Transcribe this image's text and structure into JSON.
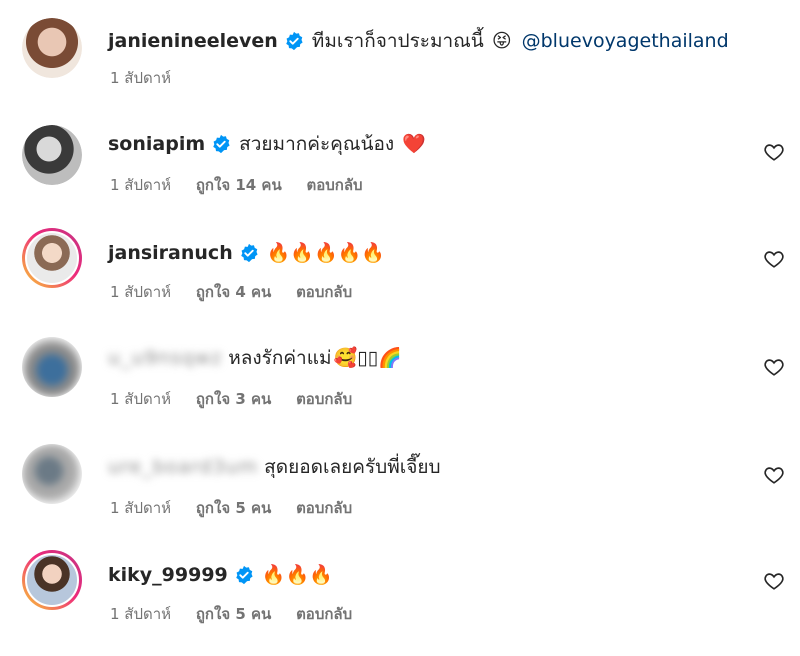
{
  "comments": [
    {
      "username": "janienineeleven",
      "text": "ทีมเราก็จาประมาณนี้",
      "emoji": "😝",
      "mention": "@bluevoyagethailand",
      "time": "1 สัปดาห์",
      "likes": "",
      "reply": ""
    },
    {
      "username": "soniapim",
      "text": "สวยมากค่ะคุณน้อง",
      "emoji": "❤️",
      "time": "1 สัปดาห์",
      "likes": "ถูกใจ 14 คน",
      "reply": "ตอบกลับ"
    },
    {
      "username": "jansiranuch",
      "text": "",
      "emoji": "🔥🔥🔥🔥🔥",
      "time": "1 สัปดาห์",
      "likes": "ถูกใจ 4 คน",
      "reply": "ตอบกลับ"
    },
    {
      "username": "u_u9nsqwz",
      "text": "หลงรักค่าแม่",
      "emoji": "🥰▯▯🌈",
      "time": "1 สัปดาห์",
      "likes": "ถูกใจ 3 คน",
      "reply": "ตอบกลับ"
    },
    {
      "username": "ure_board3um",
      "text": "สุดยอดเลยครับพี่เจี๊ยบ",
      "emoji": "",
      "time": "1 สัปดาห์",
      "likes": "ถูกใจ 5 คน",
      "reply": "ตอบกลับ"
    },
    {
      "username": "kiky_99999",
      "text": "",
      "emoji": "🔥🔥🔥",
      "time": "1 สัปดาห์",
      "likes": "ถูกใจ 5 คน",
      "reply": "ตอบกลับ"
    }
  ],
  "colors": {
    "verified": "#0095f6",
    "mention": "#00376b",
    "meta": "#737373",
    "ring_start": "#f9ce34",
    "ring_end": "#c13584"
  },
  "icons": {
    "verified": "verified-badge-icon",
    "like": "heart-outline-icon"
  }
}
